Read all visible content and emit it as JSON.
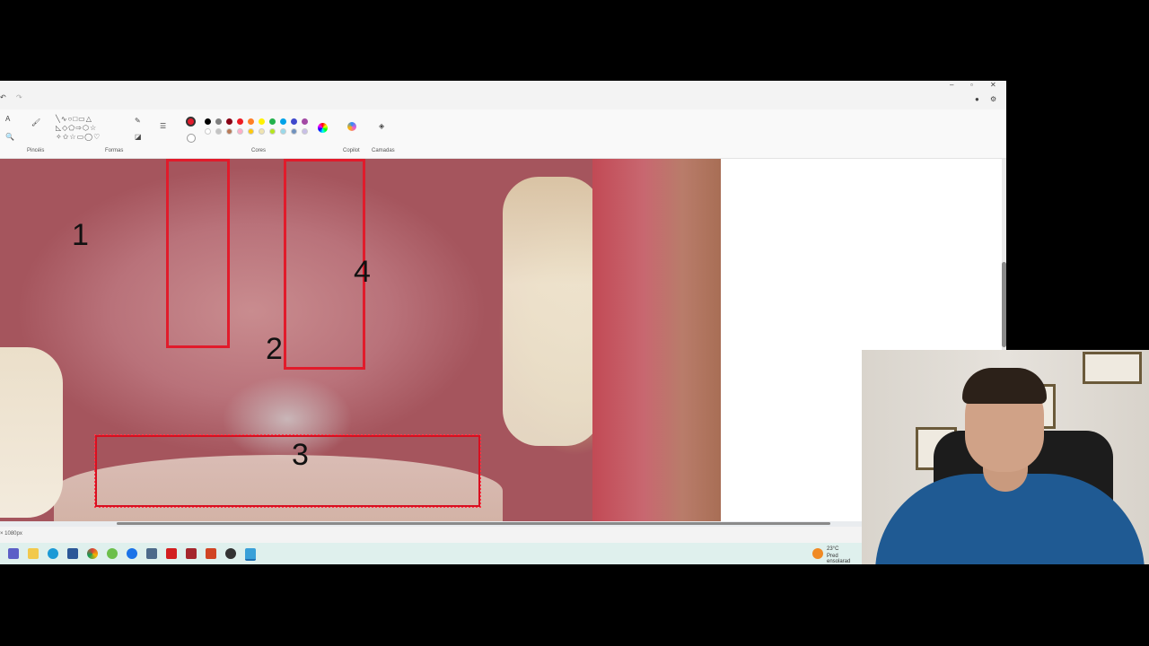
{
  "ribbon": {
    "group_brushes": "Pincéis",
    "group_shapes": "Formas",
    "group_colors": "Cores",
    "group_copilot": "Copilot",
    "group_layers": "Camadas"
  },
  "palette": [
    "#e11b2b",
    "#000000",
    "#7f7f7f",
    "#880015",
    "#ed1c24",
    "#ff7f27",
    "#fff200",
    "#22b14c",
    "#00a2e8",
    "#3f48cc",
    "#a349a4"
  ],
  "palette_row2": [
    "#ffffff",
    "#c3c3c3",
    "#b97a57",
    "#ffaec9",
    "#ffc90e",
    "#efe4b0",
    "#b5e61d",
    "#99d9ea",
    "#7092be",
    "#c8bfe7"
  ],
  "annotations": {
    "n1": "1",
    "n2": "2",
    "n3": "3",
    "n4": "4"
  },
  "status": {
    "dimensions": "× 1080px"
  },
  "weather": {
    "temp": "23°C",
    "desc": "Pred ensolarad"
  }
}
